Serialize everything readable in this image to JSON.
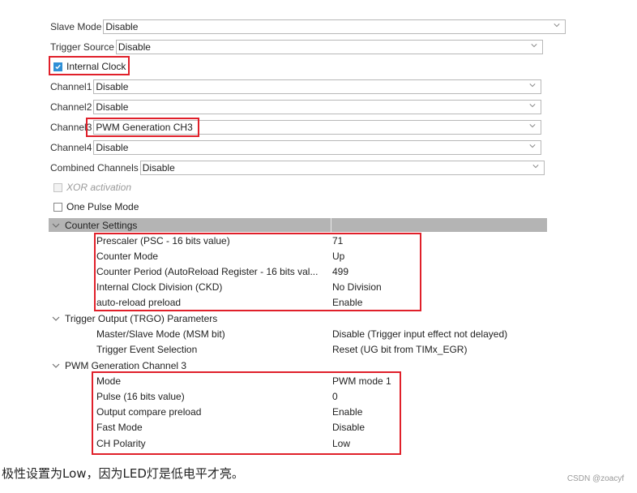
{
  "fields": {
    "slave_mode": {
      "label": "Slave Mode",
      "value": "Disable"
    },
    "trigger_source": {
      "label": "Trigger Source",
      "value": "Disable"
    },
    "internal_clock": {
      "label": "Internal Clock",
      "checked": true
    },
    "channel1": {
      "label": "Channel1",
      "value": "Disable"
    },
    "channel2": {
      "label": "Channel2",
      "value": "Disable"
    },
    "channel3": {
      "label": "Channel3",
      "value": "PWM Generation CH3"
    },
    "channel4": {
      "label": "Channel4",
      "value": "Disable"
    },
    "combined_channels": {
      "label": "Combined Channels",
      "value": "Disable"
    },
    "xor_activation": {
      "label": "XOR activation",
      "checked": false,
      "disabled": true
    },
    "one_pulse_mode": {
      "label": "One Pulse Mode",
      "checked": false
    }
  },
  "groups": {
    "counter": {
      "title": "Counter Settings",
      "params": [
        {
          "name": "Prescaler (PSC - 16 bits value)",
          "value": "71"
        },
        {
          "name": "Counter Mode",
          "value": "Up"
        },
        {
          "name": "Counter Period (AutoReload Register - 16 bits val...",
          "value": "499"
        },
        {
          "name": "Internal Clock Division (CKD)",
          "value": "No Division"
        },
        {
          "name": "auto-reload preload",
          "value": "Enable"
        }
      ]
    },
    "trgo": {
      "title": "Trigger Output (TRGO) Parameters",
      "params": [
        {
          "name": "Master/Slave Mode (MSM bit)",
          "value": "Disable (Trigger input effect not delayed)"
        },
        {
          "name": "Trigger Event Selection",
          "value": "Reset (UG bit from TIMx_EGR)"
        }
      ]
    },
    "pwm3": {
      "title": "PWM Generation Channel 3",
      "params": [
        {
          "name": "Mode",
          "value": "PWM mode 1"
        },
        {
          "name": "Pulse (16 bits value)",
          "value": "0"
        },
        {
          "name": "Output compare preload",
          "value": "Enable"
        },
        {
          "name": "Fast Mode",
          "value": "Disable"
        },
        {
          "name": "CH Polarity",
          "value": "Low"
        }
      ]
    }
  },
  "caption": "极性设置为Low，因为LED灯是低电平才亮。",
  "watermark": "CSDN @zoacyf",
  "colors": {
    "highlight": "#e0202a",
    "group_header": "#b4b4b4",
    "checkbox": "#2f8fd6"
  }
}
